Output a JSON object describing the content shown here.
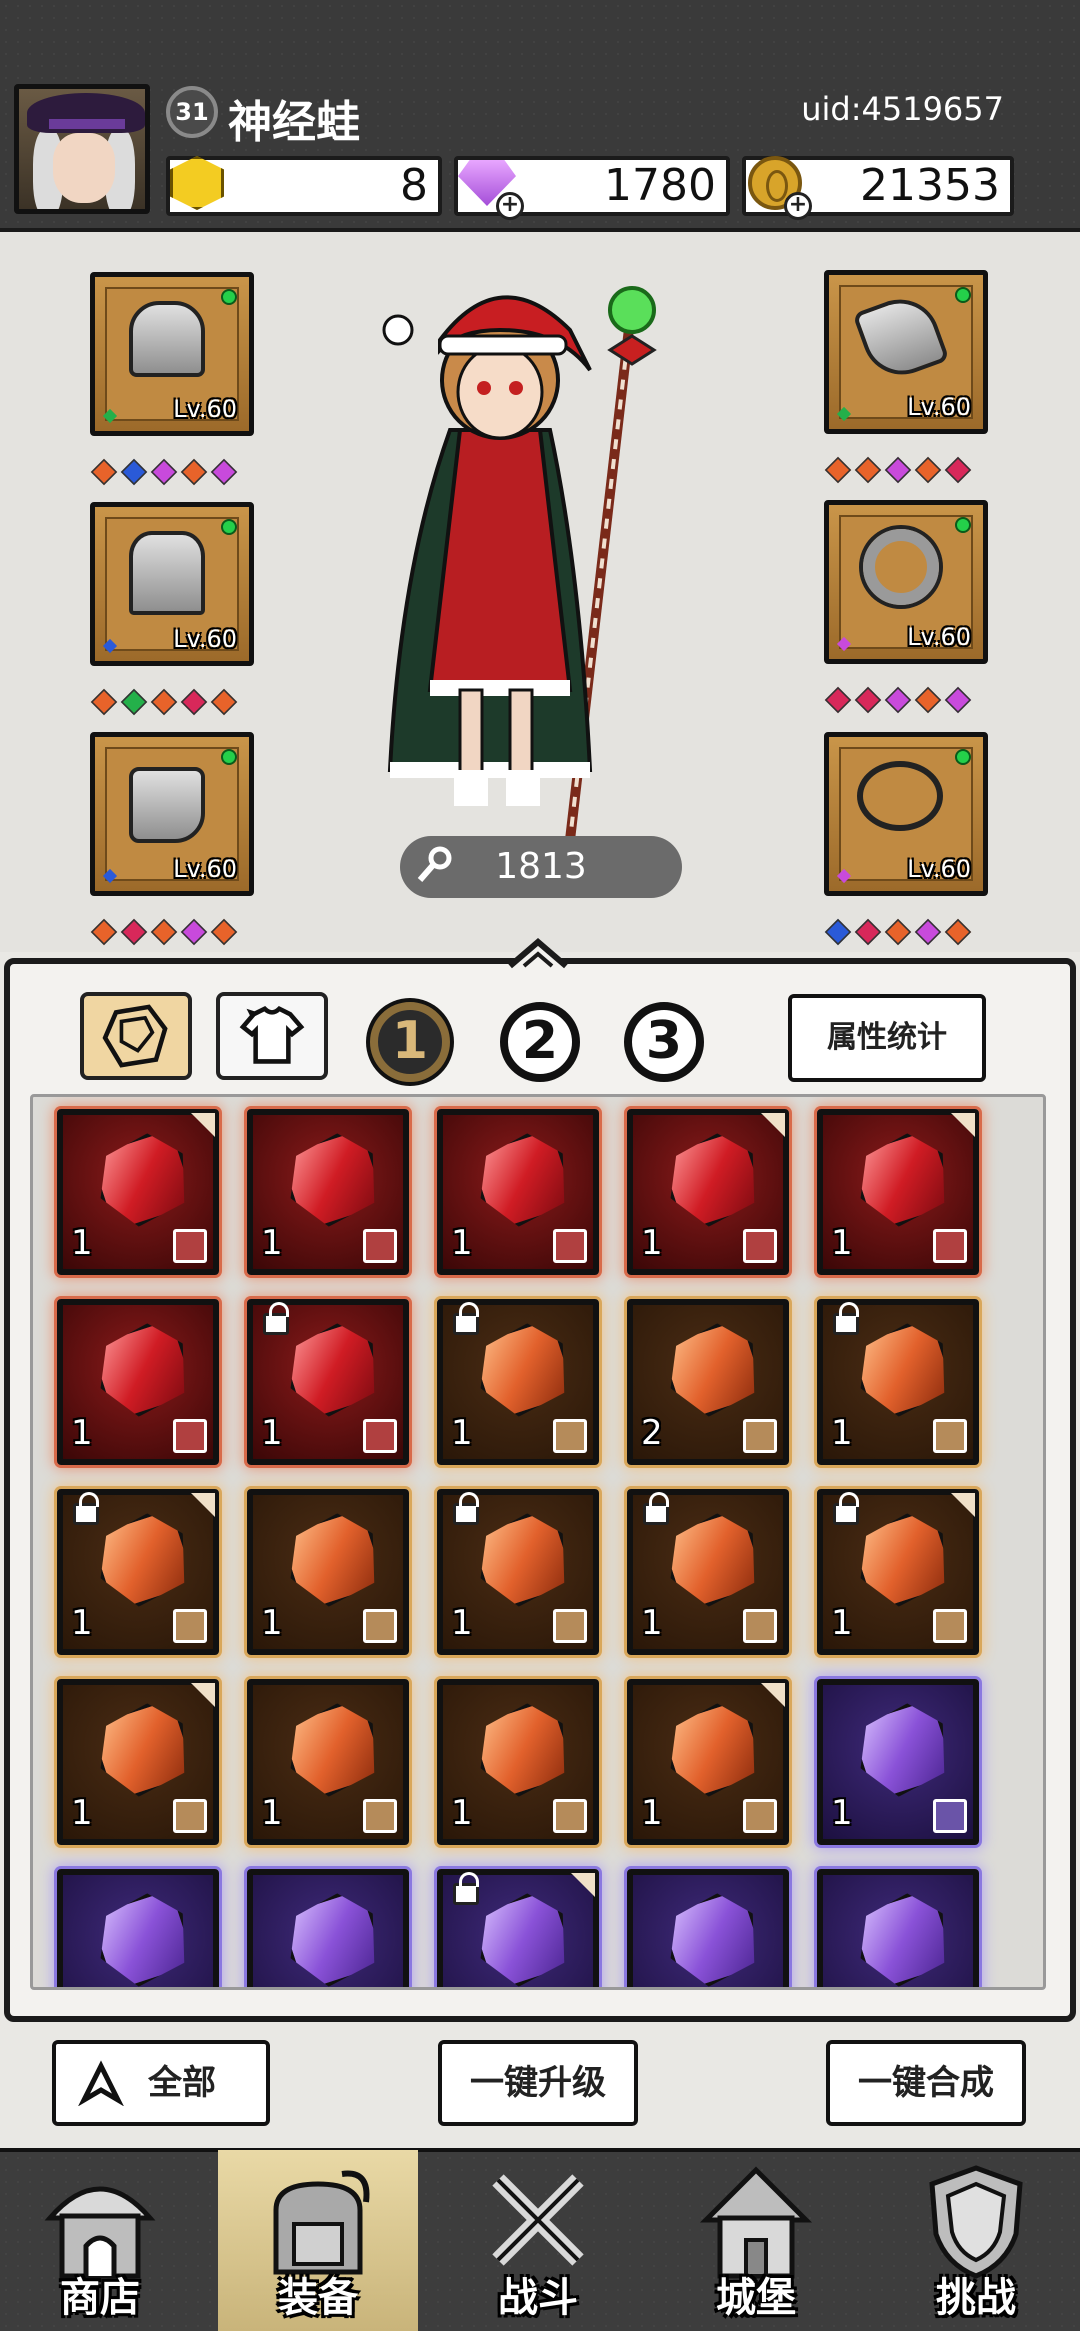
{
  "header": {
    "level": "31",
    "player_name": "神经蛙",
    "uid": "uid:4519657",
    "resources": [
      {
        "icon": "gold-hexagon-icon",
        "value": "8"
      },
      {
        "icon": "purple-diamond-icon",
        "value": "1780"
      },
      {
        "icon": "gold-coin-icon",
        "value": "21353"
      }
    ]
  },
  "equipment": {
    "left": [
      {
        "item": "helmet",
        "level": "Lv.60",
        "gems": [
          "#e8632a",
          "#2a5ad8",
          "#c84adc",
          "#e8632a",
          "#c84adc"
        ]
      },
      {
        "item": "cape",
        "level": "Lv.60",
        "gems": [
          "#e8632a",
          "#24b04a",
          "#e8632a",
          "#d8285a",
          "#e8632a"
        ]
      },
      {
        "item": "boots",
        "level": "Lv.60",
        "gems": [
          "#e8632a",
          "#d8285a",
          "#e8632a",
          "#c84adc",
          "#e8632a"
        ]
      }
    ],
    "right": [
      {
        "item": "bracer",
        "level": "Lv.60",
        "gems": [
          "#e8632a",
          "#e8632a",
          "#c84adc",
          "#e8632a",
          "#d8285a"
        ]
      },
      {
        "item": "ring",
        "level": "Lv.60",
        "gems": [
          "#d8285a",
          "#d8285a",
          "#c84adc",
          "#e8632a",
          "#c84adc"
        ]
      },
      {
        "item": "necklace",
        "level": "Lv.60",
        "gems": [
          "#2a5ad8",
          "#d8285a",
          "#e8632a",
          "#c84adc",
          "#e8632a"
        ]
      }
    ],
    "power": "1813"
  },
  "inventory": {
    "tabs": [
      "1",
      "2",
      "3"
    ],
    "active_tab": "1",
    "stats_button": "属性统计",
    "gems": [
      {
        "color": "red",
        "qty": "1",
        "lock": false,
        "fold": true
      },
      {
        "color": "red",
        "qty": "1",
        "lock": false,
        "fold": false
      },
      {
        "color": "red",
        "qty": "1",
        "lock": false,
        "fold": false
      },
      {
        "color": "red",
        "qty": "1",
        "lock": false,
        "fold": true
      },
      {
        "color": "red",
        "qty": "1",
        "lock": false,
        "fold": true
      },
      {
        "color": "red",
        "qty": "1",
        "lock": false,
        "fold": false
      },
      {
        "color": "red",
        "qty": "1",
        "lock": true,
        "fold": false
      },
      {
        "color": "orange",
        "qty": "1",
        "lock": true,
        "fold": false
      },
      {
        "color": "orange",
        "qty": "2",
        "lock": false,
        "fold": false
      },
      {
        "color": "orange",
        "qty": "1",
        "lock": true,
        "fold": false
      },
      {
        "color": "orange",
        "qty": "1",
        "lock": true,
        "fold": true
      },
      {
        "color": "orange",
        "qty": "1",
        "lock": false,
        "fold": false
      },
      {
        "color": "orange",
        "qty": "1",
        "lock": true,
        "fold": false
      },
      {
        "color": "orange",
        "qty": "1",
        "lock": true,
        "fold": false
      },
      {
        "color": "orange",
        "qty": "1",
        "lock": true,
        "fold": true
      },
      {
        "color": "orange",
        "qty": "1",
        "lock": false,
        "fold": true
      },
      {
        "color": "orange",
        "qty": "1",
        "lock": false,
        "fold": false
      },
      {
        "color": "orange",
        "qty": "1",
        "lock": false,
        "fold": false
      },
      {
        "color": "orange",
        "qty": "1",
        "lock": false,
        "fold": true
      },
      {
        "color": "purple",
        "qty": "1",
        "lock": false,
        "fold": false
      },
      {
        "color": "purple",
        "qty": "",
        "lock": false,
        "fold": false
      },
      {
        "color": "purple",
        "qty": "",
        "lock": false,
        "fold": false
      },
      {
        "color": "purple",
        "qty": "",
        "lock": true,
        "fold": true
      },
      {
        "color": "purple",
        "qty": "",
        "lock": false,
        "fold": false
      },
      {
        "color": "purple",
        "qty": "",
        "lock": false,
        "fold": false
      }
    ]
  },
  "actions": {
    "all_button": "全部",
    "upgrade_button": "一键升级",
    "merge_button": "一键合成"
  },
  "nav": [
    {
      "label": "商店",
      "icon": "shop-icon"
    },
    {
      "label": "装备",
      "icon": "bag-icon",
      "active": true
    },
    {
      "label": "战斗",
      "icon": "swords-icon"
    },
    {
      "label": "城堡",
      "icon": "castle-icon"
    },
    {
      "label": "挑战",
      "icon": "shield-icon"
    }
  ]
}
